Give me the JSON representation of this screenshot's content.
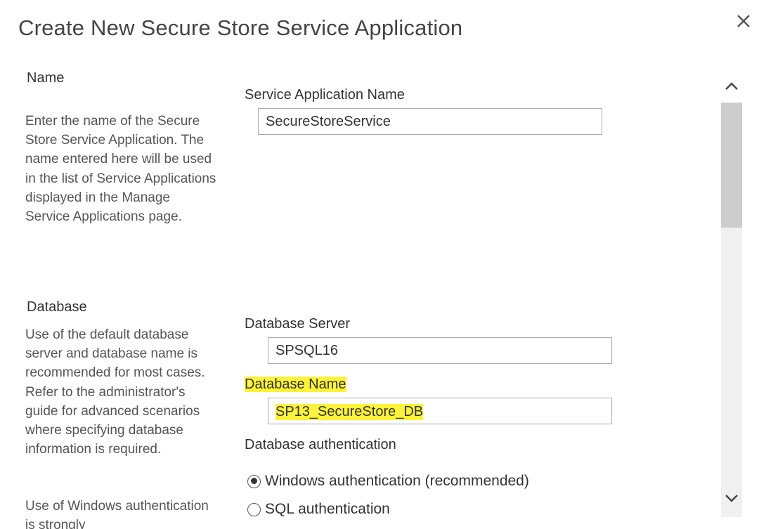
{
  "dialog": {
    "title": "Create New Secure Store Service Application",
    "close_icon": "close-icon"
  },
  "name_section": {
    "heading": "Name",
    "description": "Enter the name of the Secure Store Service Application. The name entered here will be used in the list of Service Applications displayed in the Manage Service Applications page.",
    "field_label": "Service Application Name",
    "field_value": "SecureStoreService"
  },
  "database_section": {
    "heading": "Database",
    "description": "Use of the default database server and database name is recommended for most cases. Refer to the administrator's guide for advanced scenarios where specifying database information is required.",
    "description2": "Use of Windows authentication is strongly",
    "server_label": "Database Server",
    "server_value": "SPSQL16",
    "dbname_label": "Database Name",
    "dbname_value": "SP13_SecureStore_DB",
    "auth_label": "Database authentication",
    "auth_options": [
      {
        "label": "Windows authentication (recommended)",
        "checked": true
      },
      {
        "label": "SQL authentication",
        "checked": false
      }
    ]
  },
  "scrollbar": {
    "up_icon": "chevron-up-icon",
    "down_icon": "chevron-down-icon"
  },
  "colors": {
    "highlight": "#fcf33a",
    "text": "#444444",
    "border": "#ababab"
  }
}
